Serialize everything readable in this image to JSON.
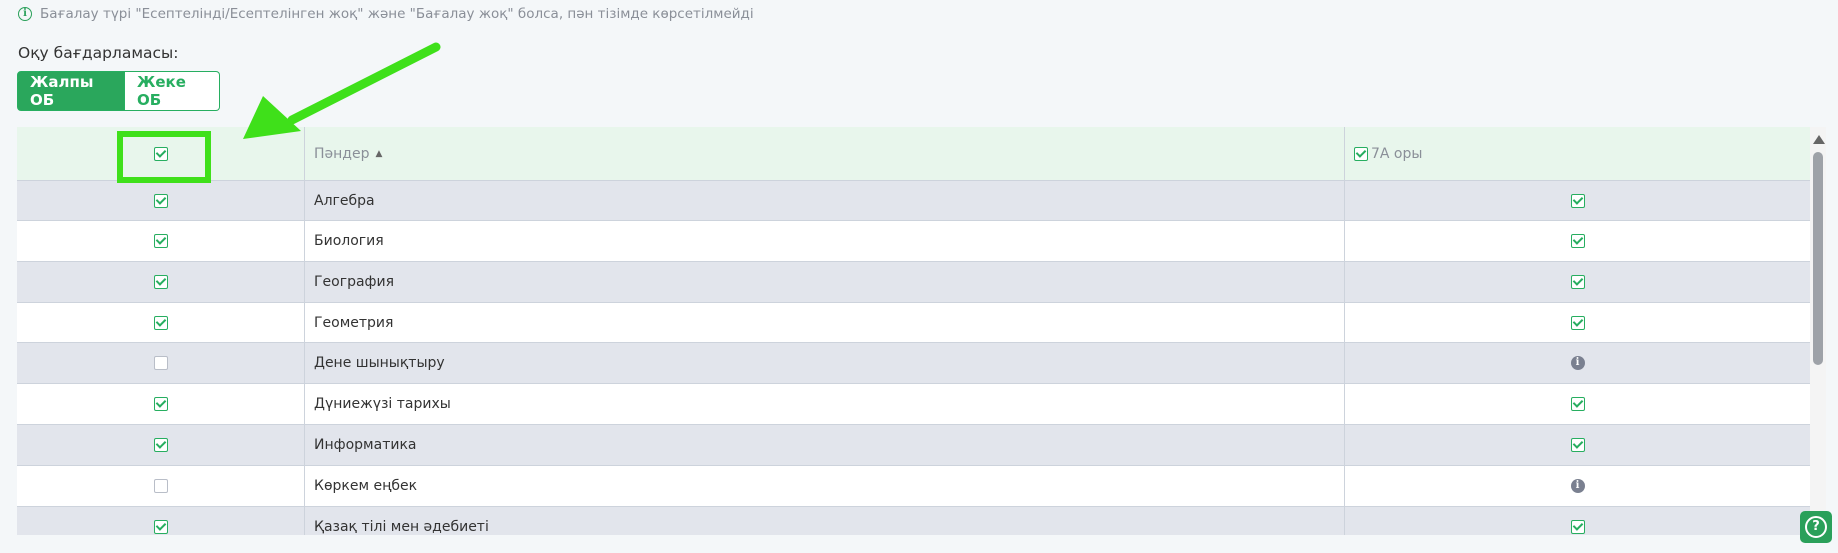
{
  "notice": {
    "icon": "info-icon",
    "text": "Бағалау түрі \"Есептелінді/Есептелінген жоқ\" және \"Бағалау жоқ\" болса, пән тізімде көрсетілмейді"
  },
  "program": {
    "label": "Оқу бағдарламасы:",
    "options": [
      "Жалпы ОБ",
      "Жеке ОБ"
    ],
    "selected": "Жалпы ОБ"
  },
  "table": {
    "header": {
      "subjects_label": "Пәндер",
      "class_label": "7А оры",
      "select_all_checked": true
    },
    "rows": [
      {
        "subject": "Алгебра",
        "checked": true,
        "class_status": "checked"
      },
      {
        "subject": "Биология",
        "checked": true,
        "class_status": "checked"
      },
      {
        "subject": "География",
        "checked": true,
        "class_status": "checked"
      },
      {
        "subject": "Геометрия",
        "checked": true,
        "class_status": "checked"
      },
      {
        "subject": "Дене шынықтыру",
        "checked": false,
        "class_status": "info"
      },
      {
        "subject": "Дүниежүзі тарихы",
        "checked": true,
        "class_status": "checked"
      },
      {
        "subject": "Информатика",
        "checked": true,
        "class_status": "checked"
      },
      {
        "subject": "Көркем еңбек",
        "checked": false,
        "class_status": "info"
      },
      {
        "subject": "Қазақ тілі мен әдебиеті",
        "checked": true,
        "class_status": "checked"
      }
    ]
  },
  "help": {
    "icon": "help-icon",
    "glyph": "?"
  },
  "colors": {
    "accent": "#2aa75c",
    "annotation": "#3fe01a",
    "header_bg": "#e8f6ec",
    "odd_row_bg": "#e2e5ec"
  }
}
